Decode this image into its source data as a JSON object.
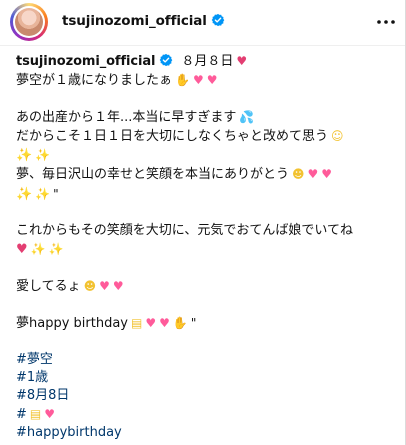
{
  "header": {
    "username": "tsujinozomi_official",
    "more_icon": "more-horizontal-icon"
  },
  "caption": {
    "username": "tsujinozomi_official",
    "date": "８月８日",
    "lines": [
      "夢空が１歳になりましたぁ",
      "",
      "あの出産から１年...本当に早すぎます",
      "だからこそ１日１日を大切にしなくちゃと改めて思う",
      "",
      "夢、毎日沢山の幸せと笑顔を本当にありがとう",
      "",
      "",
      "これからもその笑顔を大切に、元気でおてんば娘でいてね",
      "",
      "",
      "愛してるょ",
      "",
      "夢happy birthday",
      ""
    ],
    "hashtags": [
      "#夢空",
      "#1歳",
      "#8月8日",
      "#",
      "#happybirthday"
    ]
  },
  "colors": {
    "hashtag": "#00376b",
    "verified": "#0095f6",
    "heart": "#e33e72"
  }
}
